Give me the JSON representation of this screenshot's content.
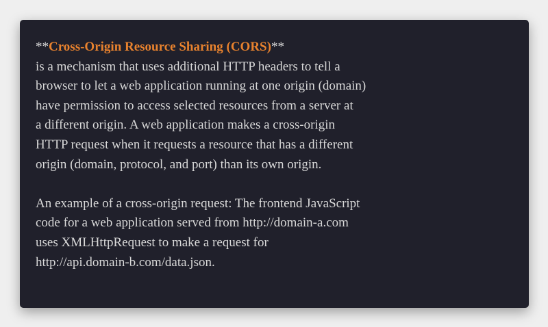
{
  "definition": {
    "prefix": "**",
    "term": "Cross-Origin Resource Sharing (CORS)",
    "suffix": "**",
    "lines": [
      "is a mechanism that uses additional HTTP headers to tell a",
      "browser to let a web application running at one origin (domain)",
      "have permission to access selected resources from a server at",
      "a different origin. A web application makes a cross-origin",
      "HTTP request when it requests a resource that has a different",
      "origin (domain, protocol, and port) than its own origin."
    ]
  },
  "example": {
    "lines": [
      "An example of a cross-origin request: The frontend JavaScript",
      "code for a web application served from http://domain-a.com",
      "uses XMLHttpRequest to make a request for",
      "http://api.domain-b.com/data.json."
    ]
  },
  "colors": {
    "card_background": "#20202b",
    "page_background": "#efefef",
    "text": "#d8d8d8",
    "accent": "#e8822e"
  }
}
